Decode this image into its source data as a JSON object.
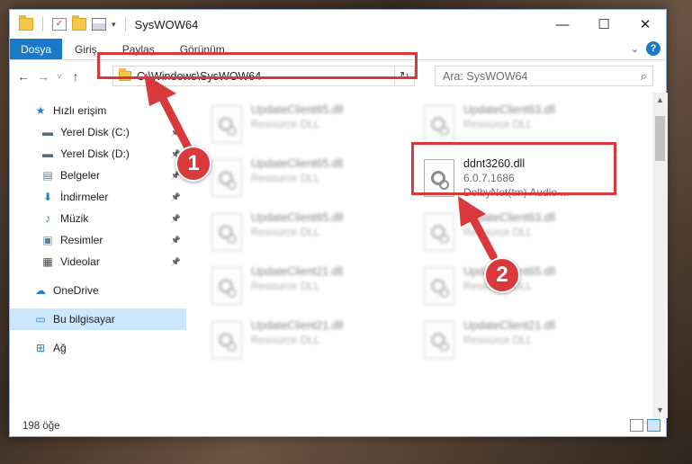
{
  "window": {
    "title": "SysWOW64",
    "controls": {
      "minimize": "—",
      "maximize": "☐",
      "close": "✕"
    }
  },
  "ribbon": {
    "tabs": [
      "Dosya",
      "Giriş",
      "Paylaş",
      "Görünüm"
    ],
    "expand_icon": "chevron-down-icon",
    "help": "?"
  },
  "navbar": {
    "back": "←",
    "forward": "→",
    "recent": "˅",
    "up": "↑",
    "address_path": "C:\\Windows\\SysWOW64",
    "search_placeholder": "Ara: SysWOW64"
  },
  "sidebar": {
    "items": [
      {
        "label": "Hızlı erişim",
        "icon": "star-icon",
        "pinned": false
      },
      {
        "label": "Yerel Disk (C:)",
        "icon": "drive-icon",
        "pinned": true
      },
      {
        "label": "Yerel Disk (D:)",
        "icon": "drive-icon",
        "pinned": true
      },
      {
        "label": "Belgeler",
        "icon": "documents-icon",
        "pinned": true
      },
      {
        "label": "İndirmeler",
        "icon": "download-icon",
        "pinned": true
      },
      {
        "label": "Müzik",
        "icon": "music-icon",
        "pinned": true
      },
      {
        "label": "Resimler",
        "icon": "pictures-icon",
        "pinned": true
      },
      {
        "label": "Videolar",
        "icon": "video-icon",
        "pinned": true
      },
      {
        "label": "OneDrive",
        "icon": "cloud-icon",
        "pinned": false
      },
      {
        "label": "Bu bilgisayar",
        "icon": "computer-icon",
        "pinned": false
      },
      {
        "label": "Ağ",
        "icon": "network-icon",
        "pinned": false
      }
    ]
  },
  "files": {
    "highlighted": {
      "name": "ddnt3260.dll",
      "version": "6.0.7.1686",
      "description": "DolbyNet(tm) Audio ..."
    },
    "blurred": [
      {
        "name": "UpdateClient65.dll",
        "type": "Resource DLL"
      },
      {
        "name": "UpdateClient63.dll",
        "type": "Resource DLL"
      },
      {
        "name": "UpdateClient65.dll",
        "type": "Resource DLL"
      },
      {
        "name": "UpdateClient65.dll",
        "type": "Resource DLL"
      },
      {
        "name": "UpdateClient63.dll",
        "type": "Resource DLL"
      },
      {
        "name": "UpdateClient21.dll",
        "type": "Resource DLL"
      },
      {
        "name": "UpdateClient65.dll",
        "type": "Resource DLL"
      },
      {
        "name": "UpdateClient21.dll",
        "type": "Resource DLL"
      },
      {
        "name": "UpdateClient21.dll",
        "type": "Resource DLL"
      }
    ]
  },
  "statusbar": {
    "item_count": "198 öğe"
  },
  "annotations": {
    "step1": "1",
    "step2": "2",
    "color": "#d9393b"
  }
}
